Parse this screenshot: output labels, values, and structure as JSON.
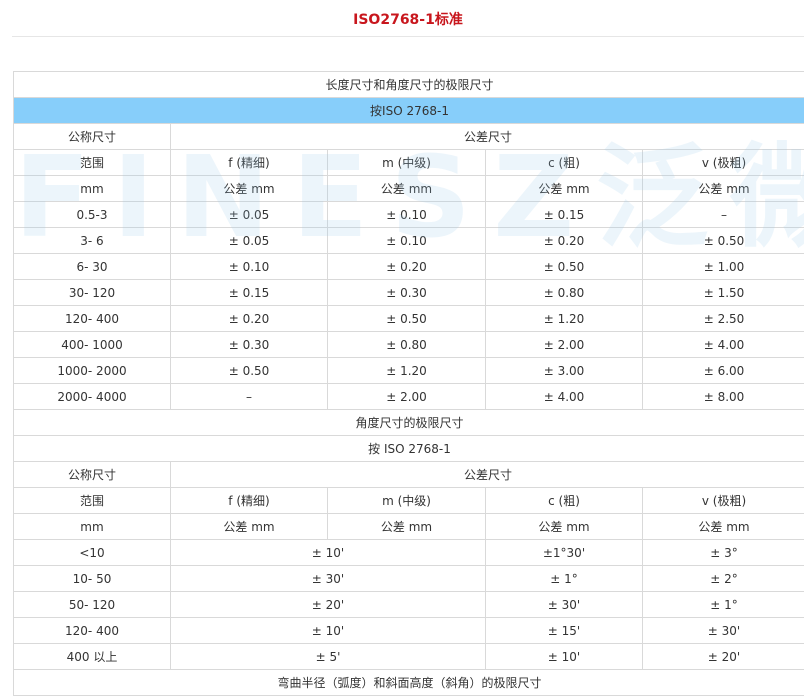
{
  "title": "ISO2768-1标准",
  "watermark": "FINESZ泛微",
  "colors": {
    "title": "#c8161d",
    "header_band": "#87cefa"
  },
  "linear": {
    "heading": "长度尺寸和角度尺寸的极限尺寸",
    "standard": "按ISO 2768-1",
    "nominal": "公称尺寸",
    "tolerance": "公差尺寸",
    "classes_row": [
      "范围",
      "f (精细)",
      "m (中级)",
      "c (粗)",
      "v (极粗)"
    ],
    "units_row": [
      "mm",
      "公差 mm",
      "公差 mm",
      "公差 mm",
      "公差 mm"
    ],
    "rows": [
      [
        "0.5-3",
        "± 0.05",
        "± 0.10",
        "± 0.15",
        "–"
      ],
      [
        "3- 6",
        "± 0.05",
        "± 0.10",
        "± 0.20",
        "± 0.50"
      ],
      [
        "6- 30",
        "± 0.10",
        "± 0.20",
        "± 0.50",
        "± 1.00"
      ],
      [
        "30- 120",
        "± 0.15",
        "± 0.30",
        "± 0.80",
        "± 1.50"
      ],
      [
        "120- 400",
        "± 0.20",
        "± 0.50",
        "± 1.20",
        "± 2.50"
      ],
      [
        "400- 1000",
        "± 0.30",
        "± 0.80",
        "± 2.00",
        "± 4.00"
      ],
      [
        "1000- 2000",
        "± 0.50",
        "± 1.20",
        "± 3.00",
        "± 6.00"
      ],
      [
        "2000- 4000",
        "–",
        "± 2.00",
        "± 4.00",
        "± 8.00"
      ]
    ]
  },
  "angular": {
    "heading": "角度尺寸的极限尺寸",
    "standard": "按 ISO 2768-1",
    "nominal": "公称尺寸",
    "tolerance": "公差尺寸",
    "classes_row": [
      "范围",
      "f (精细)",
      "m (中级)",
      "c (粗)",
      "v (极粗)"
    ],
    "units_row": [
      "mm",
      "公差 mm",
      "公差 mm",
      "公差 mm",
      "公差 mm"
    ],
    "rows": [
      [
        "<10",
        "± 10'",
        "±1°30'",
        "± 3°"
      ],
      [
        "10- 50",
        "± 30'",
        "± 1°",
        "± 2°"
      ],
      [
        "50- 120",
        "± 20'",
        "± 30'",
        "± 1°"
      ],
      [
        "120- 400",
        "± 10'",
        "± 15'",
        "± 30'"
      ],
      [
        "400 以上",
        "± 5'",
        "± 10'",
        "± 20'"
      ]
    ]
  },
  "bend": {
    "heading": "弯曲半径（弧度）和斜面高度（斜角）的极限尺寸"
  }
}
